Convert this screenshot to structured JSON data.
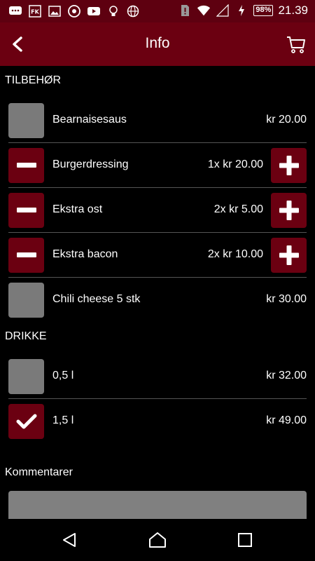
{
  "status_bar": {
    "battery": "98%",
    "time": "21.39"
  },
  "app_bar": {
    "title": "Info"
  },
  "sections": {
    "tilbehor": {
      "title": "TILBEHØR",
      "items": [
        {
          "name": "Bearnaisesaus",
          "price": "kr 20.00",
          "state": "unchecked"
        },
        {
          "name": "Burgerdressing",
          "price": "1x kr 20.00",
          "state": "quantity"
        },
        {
          "name": "Ekstra ost",
          "price": "2x kr 5.00",
          "state": "quantity"
        },
        {
          "name": "Ekstra bacon",
          "price": "2x kr 10.00",
          "state": "quantity"
        },
        {
          "name": "Chili cheese 5 stk",
          "price": "kr 30.00",
          "state": "unchecked"
        }
      ]
    },
    "drikke": {
      "title": "DRIKKE",
      "items": [
        {
          "name": "0,5 l",
          "price": "kr 32.00",
          "state": "unchecked"
        },
        {
          "name": "1,5 l",
          "price": "kr 49.00",
          "state": "checked"
        }
      ]
    }
  },
  "comments": {
    "label": "Kommentarer",
    "value": ""
  },
  "colors": {
    "accent": "#6b0011",
    "status_bar": "#5e0010",
    "unchecked_box": "#7a7a7a"
  }
}
